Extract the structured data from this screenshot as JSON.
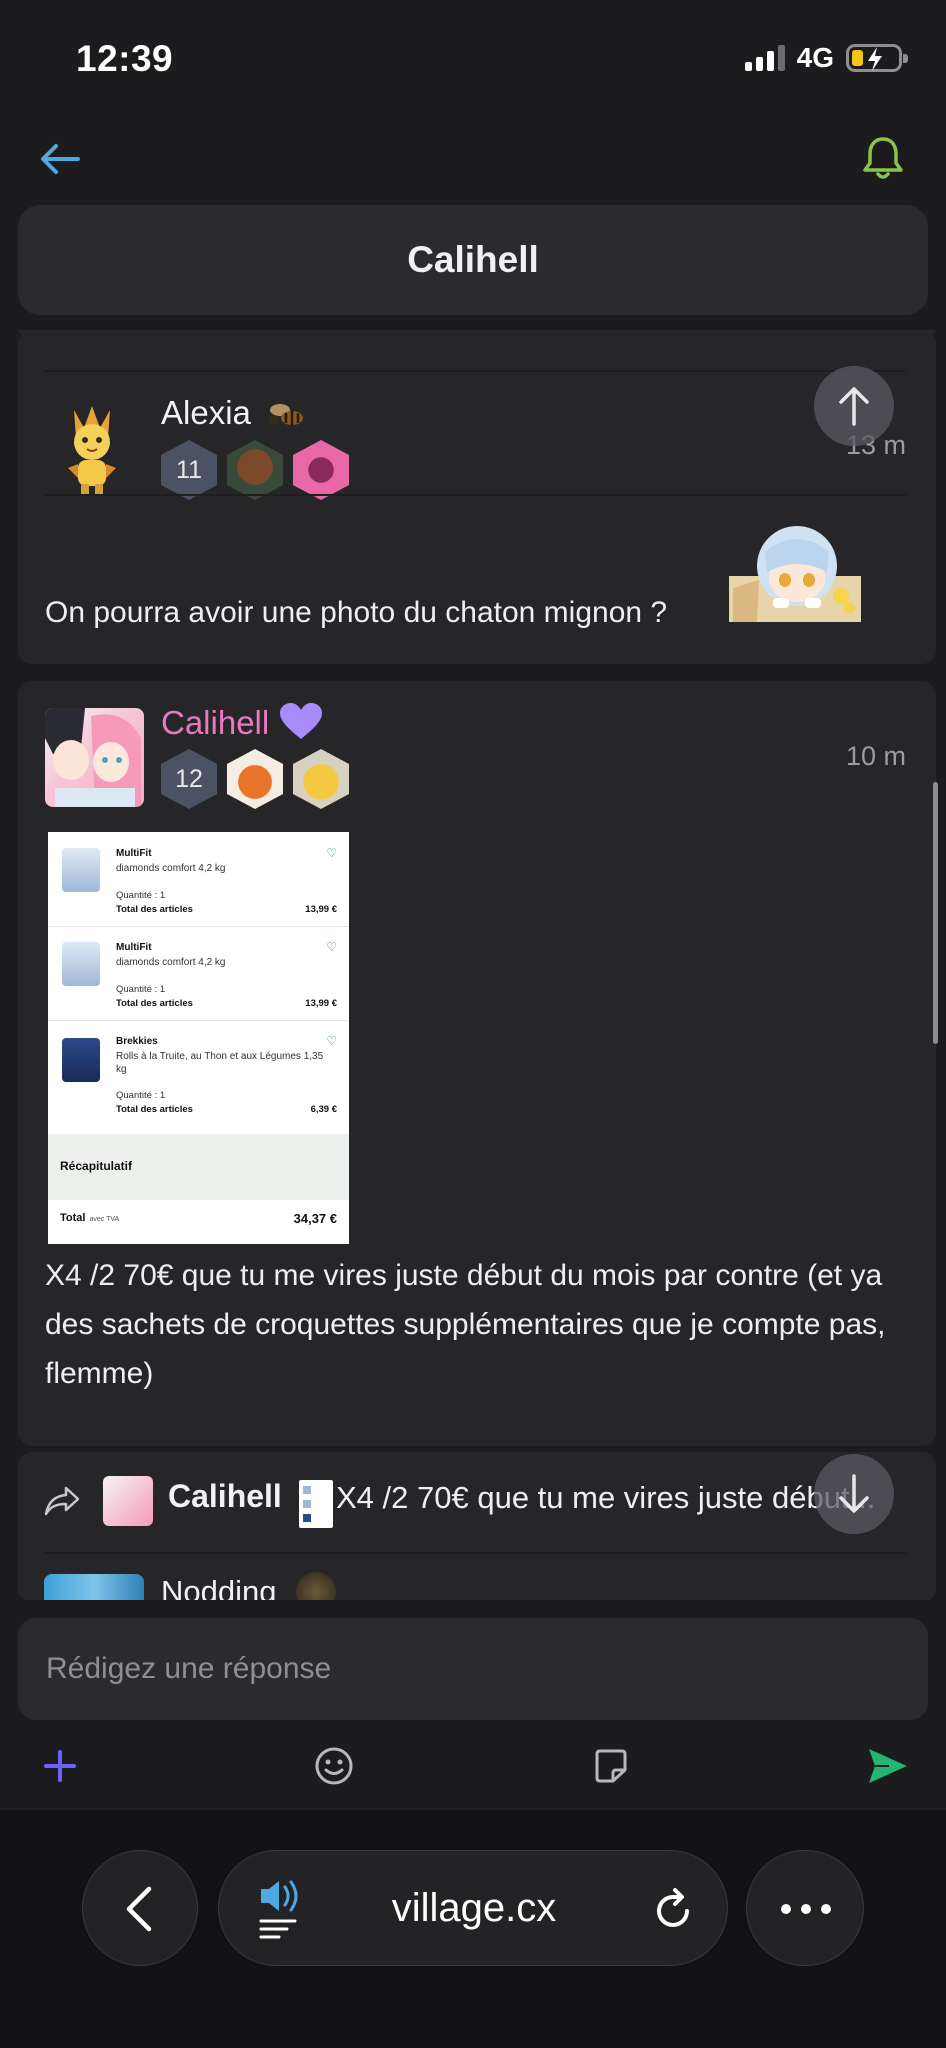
{
  "status_bar": {
    "time": "12:39",
    "network": "4G"
  },
  "header": {
    "title": "Calihell"
  },
  "posts": [
    {
      "username": "Alexia",
      "level": "11",
      "time": "13 m",
      "text": "On pourra avoir une photo du chaton mignon ?"
    },
    {
      "username": "Calihell",
      "level": "12",
      "time": "10 m",
      "text": "X4 /2 70€ que tu me vires juste début du mois par contre (et ya des sachets de croquettes supplémentaires que je compte pas, flemme)",
      "receipt": {
        "items": [
          {
            "brand": "MultiFit",
            "desc": "diamonds comfort 4,2 kg",
            "qty": "Quantité : 1",
            "total_label": "Total des articles",
            "price": "13,99 €"
          },
          {
            "brand": "MultiFit",
            "desc": "diamonds comfort 4,2 kg",
            "qty": "Quantité : 1",
            "total_label": "Total des articles",
            "price": "13,99 €"
          },
          {
            "brand": "Brekkies",
            "desc": "Rolls à la Truite, au Thon et aux Légumes 1,35 kg",
            "qty": "Quantité : 1",
            "total_label": "Total des articles",
            "price": "6,39 €"
          }
        ],
        "summary": "Récapitulatif",
        "total_label": "Total",
        "total_sub": "avec TVA",
        "total_value": "34,37 €"
      }
    }
  ],
  "quote": {
    "username": "Calihell",
    "text": "X4 /2 70€ que tu me vires juste début..."
  },
  "next_post": {
    "username": "Nodding"
  },
  "composer": {
    "placeholder": "Rédigez une réponse"
  },
  "browser": {
    "url": "village.cx"
  },
  "colors": {
    "accent_link": "#4fa8e0",
    "bell": "#8bc34a",
    "calihell_name": "#e879c0",
    "send": "#22b573",
    "plus": "#6b63ff",
    "heart": "#a78bfa"
  }
}
